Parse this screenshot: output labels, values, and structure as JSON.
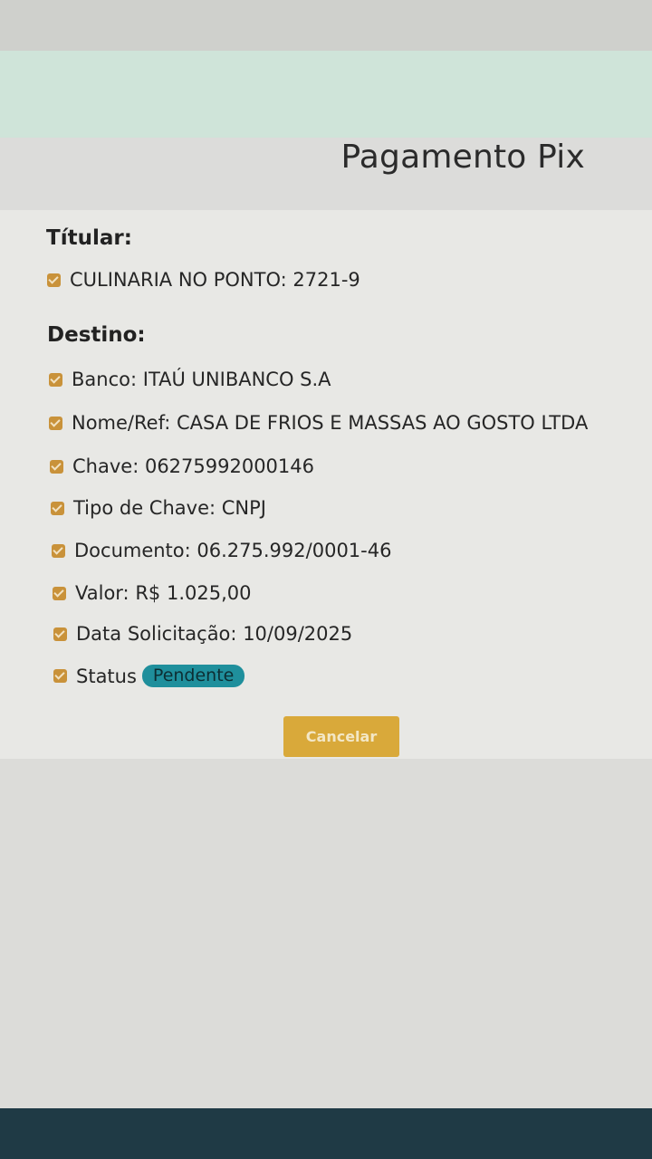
{
  "header": {
    "title": "Pagamento Pix"
  },
  "titular": {
    "label": "Títular:",
    "value": "CULINARIA NO PONTO: 2721-9"
  },
  "destino": {
    "label": "Destino:",
    "items": [
      {
        "label": "Banco:",
        "value": "ITAÚ UNIBANCO S.A"
      },
      {
        "label": "Nome/Ref:",
        "value": "CASA DE FRIOS E MASSAS AO GOSTO LTDA"
      },
      {
        "label": "Chave:",
        "value": "06275992000146"
      },
      {
        "label": "Tipo de Chave:",
        "value": "CNPJ"
      },
      {
        "label": "Documento:",
        "value": "06.275.992/0001-46"
      },
      {
        "label": "Valor:",
        "value": "R$ 1.025,00"
      },
      {
        "label": "Data Solicitação:",
        "value": "10/09/2025"
      }
    ],
    "status": {
      "label": "Status",
      "value": "Pendente"
    }
  },
  "actions": {
    "cancel_label": "Cancelar"
  },
  "colors": {
    "accent": "#d9a93a",
    "check": "#c9923a",
    "status_badge": "#1f8f9c",
    "header_band": "#cfe4d9"
  },
  "icons": {
    "check": "checkbox-checked-icon"
  }
}
